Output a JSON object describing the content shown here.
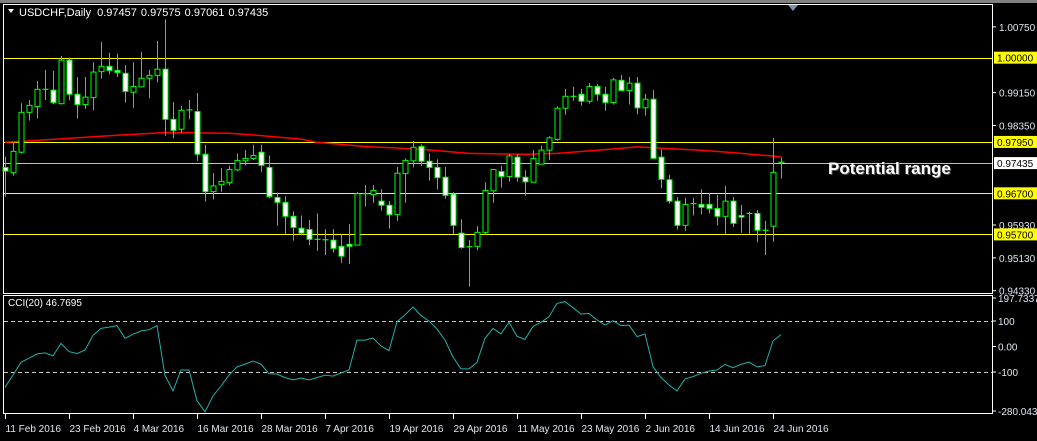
{
  "header": {
    "symbol_tf": "USDCHF,Daily",
    "open": "0.97457",
    "high": "0.97575",
    "low": "0.97061",
    "close": "0.97435"
  },
  "annotation": "Potential range",
  "colors": {
    "bull_body": "#000000",
    "bear_body": "#ffffff",
    "candle_outline": "#00ff00",
    "ma": "#ff0000",
    "level": "#ffff00",
    "current_price": "#c0c0c0",
    "cci": "#20b2aa"
  },
  "price_axis": {
    "ticks": [
      "1.00750",
      "0.99150",
      "0.98350",
      "0.95930",
      "0.95130",
      "0.94330"
    ],
    "levels": [
      "1.00000",
      "0.97950",
      "0.96700",
      "0.95700"
    ],
    "current": "0.97435"
  },
  "cci": {
    "label": "CCI(20) 46.7695",
    "axis": [
      "197.7337",
      "100",
      "0.00",
      "-100",
      "-280.0437"
    ],
    "values": [
      -160,
      -112,
      -62,
      -46,
      -29,
      -25,
      -37,
      12,
      -20,
      -28,
      -14,
      44,
      71,
      76,
      82,
      32,
      48,
      61,
      66,
      82,
      -114,
      -174,
      -92,
      -92,
      -212,
      -256,
      -194,
      -155,
      -112,
      -80,
      -69,
      -57,
      -69,
      -107,
      -108,
      -122,
      -131,
      -124,
      -131,
      -122,
      -112,
      -116,
      -104,
      -92,
      25,
      25,
      33,
      2,
      -16,
      97,
      124,
      155,
      121,
      100,
      69,
      25,
      -41,
      -88,
      -88,
      -62,
      32,
      71,
      50,
      95,
      40,
      28,
      79,
      95,
      117,
      169,
      176,
      152,
      127,
      130,
      104,
      84,
      101,
      82,
      84,
      39,
      49,
      -79,
      -122,
      -151,
      -174,
      -127,
      -118,
      -105,
      -96,
      -92,
      -70,
      -83,
      -70,
      -61,
      -80,
      -75,
      22,
      46.7695
    ]
  },
  "dates": [
    {
      "bar": 0,
      "label": "11 Feb 2016"
    },
    {
      "bar": 8,
      "label": "23 Feb 2016"
    },
    {
      "bar": 16,
      "label": "4 Mar 2016"
    },
    {
      "bar": 24,
      "label": "16 Mar 2016"
    },
    {
      "bar": 32,
      "label": "28 Mar 2016"
    },
    {
      "bar": 40,
      "label": "7 Apr 2016"
    },
    {
      "bar": 48,
      "label": "19 Apr 2016"
    },
    {
      "bar": 56,
      "label": "29 Apr 2016"
    },
    {
      "bar": 64,
      "label": "11 May 2016"
    },
    {
      "bar": 72,
      "label": "23 May 2016"
    },
    {
      "bar": 80,
      "label": "2 Jun 2016"
    },
    {
      "bar": 88,
      "label": "14 Jun 2016"
    },
    {
      "bar": 96,
      "label": "24 Jun 2016"
    }
  ],
  "chart_data": {
    "type": "candlestick",
    "symbol": "USDCHF",
    "timeframe": "Daily",
    "ylim": [
      0.9433,
      1.0075
    ],
    "levels": [
      1.0,
      0.9795,
      0.967,
      0.957
    ],
    "current_price": 0.97435,
    "ohlc": [
      [
        0.9733,
        0.9759,
        0.9662,
        0.9724
      ],
      [
        0.972,
        0.9793,
        0.9713,
        0.9772
      ],
      [
        0.977,
        0.9889,
        0.9767,
        0.9867
      ],
      [
        0.9867,
        0.9897,
        0.9847,
        0.9884
      ],
      [
        0.9881,
        0.9943,
        0.9852,
        0.9923
      ],
      [
        0.9923,
        0.997,
        0.9897,
        0.9922
      ],
      [
        0.9921,
        0.9968,
        0.9887,
        0.9891
      ],
      [
        0.9888,
        1.0004,
        0.9886,
        0.9994
      ],
      [
        0.9994,
        1.0,
        0.9896,
        0.9911
      ],
      [
        0.9911,
        0.9953,
        0.9852,
        0.9886
      ],
      [
        0.9886,
        0.9953,
        0.9875,
        0.9904
      ],
      [
        0.9903,
        0.9989,
        0.9872,
        0.9965
      ],
      [
        0.9966,
        1.0038,
        0.9949,
        0.9979
      ],
      [
        0.9979,
        1.0012,
        0.9959,
        0.9969
      ],
      [
        0.9969,
        1.001,
        0.9953,
        0.9964
      ],
      [
        0.9962,
        0.9982,
        0.9891,
        0.9918
      ],
      [
        0.9916,
        0.9989,
        0.9878,
        0.993
      ],
      [
        0.9929,
        1.0014,
        0.9928,
        0.995
      ],
      [
        0.995,
        0.997,
        0.9901,
        0.9957
      ],
      [
        0.9957,
        1.0041,
        0.994,
        0.9972
      ],
      [
        0.9972,
        1.0093,
        0.981,
        0.985
      ],
      [
        0.985,
        0.9892,
        0.9804,
        0.9823
      ],
      [
        0.9826,
        0.9882,
        0.9816,
        0.9872
      ],
      [
        0.987,
        0.9897,
        0.985,
        0.9873
      ],
      [
        0.9869,
        0.9914,
        0.9749,
        0.9765
      ],
      [
        0.9765,
        0.9788,
        0.965,
        0.9674
      ],
      [
        0.9674,
        0.9719,
        0.9655,
        0.9688
      ],
      [
        0.9691,
        0.9732,
        0.9674,
        0.9699
      ],
      [
        0.9696,
        0.9737,
        0.9689,
        0.9728
      ],
      [
        0.9727,
        0.9767,
        0.9724,
        0.975
      ],
      [
        0.9749,
        0.9775,
        0.9738,
        0.9755
      ],
      [
        0.9755,
        0.9788,
        0.9751,
        0.9762
      ],
      [
        0.977,
        0.9788,
        0.9722,
        0.9738
      ],
      [
        0.9733,
        0.9762,
        0.9658,
        0.9662
      ],
      [
        0.966,
        0.9672,
        0.9591,
        0.9648
      ],
      [
        0.9648,
        0.9663,
        0.9571,
        0.9614
      ],
      [
        0.9614,
        0.9626,
        0.9555,
        0.9587
      ],
      [
        0.9585,
        0.9616,
        0.9568,
        0.9573
      ],
      [
        0.9582,
        0.9605,
        0.9544,
        0.9558
      ],
      [
        0.9558,
        0.9621,
        0.953,
        0.9557
      ],
      [
        0.9557,
        0.9583,
        0.952,
        0.9556
      ],
      [
        0.9556,
        0.9583,
        0.9526,
        0.9536
      ],
      [
        0.9541,
        0.957,
        0.9501,
        0.9517
      ],
      [
        0.9546,
        0.9595,
        0.9498,
        0.9541
      ],
      [
        0.9544,
        0.9673,
        0.9543,
        0.9669
      ],
      [
        0.9669,
        0.969,
        0.9638,
        0.9668
      ],
      [
        0.9667,
        0.969,
        0.9647,
        0.9677
      ],
      [
        0.9651,
        0.968,
        0.9628,
        0.9641
      ],
      [
        0.9641,
        0.9651,
        0.9584,
        0.9618
      ],
      [
        0.9618,
        0.9734,
        0.9603,
        0.9719
      ],
      [
        0.9718,
        0.9755,
        0.9647,
        0.975
      ],
      [
        0.9749,
        0.9797,
        0.9733,
        0.9782
      ],
      [
        0.9784,
        0.9789,
        0.9736,
        0.9748
      ],
      [
        0.9748,
        0.9767,
        0.9701,
        0.9733
      ],
      [
        0.9733,
        0.9753,
        0.9679,
        0.9708
      ],
      [
        0.9709,
        0.9734,
        0.9657,
        0.9665
      ],
      [
        0.9668,
        0.9673,
        0.957,
        0.9592
      ],
      [
        0.9573,
        0.9607,
        0.9535,
        0.9538
      ],
      [
        0.9538,
        0.9556,
        0.9443,
        0.954
      ],
      [
        0.9541,
        0.959,
        0.9532,
        0.9575
      ],
      [
        0.9575,
        0.9697,
        0.9569,
        0.9677
      ],
      [
        0.9676,
        0.9728,
        0.9647,
        0.9728
      ],
      [
        0.9723,
        0.9737,
        0.9684,
        0.9711
      ],
      [
        0.9711,
        0.9766,
        0.9698,
        0.9761
      ],
      [
        0.9758,
        0.9765,
        0.9698,
        0.9709
      ],
      [
        0.9709,
        0.9726,
        0.9664,
        0.9698
      ],
      [
        0.9697,
        0.9775,
        0.9697,
        0.9755
      ],
      [
        0.9741,
        0.9786,
        0.9741,
        0.9775
      ],
      [
        0.9775,
        0.9809,
        0.9751,
        0.9805
      ],
      [
        0.9801,
        0.9882,
        0.9798,
        0.9877
      ],
      [
        0.9877,
        0.9924,
        0.9861,
        0.9906
      ],
      [
        0.9906,
        0.9929,
        0.9895,
        0.9905
      ],
      [
        0.9911,
        0.9924,
        0.9883,
        0.9894
      ],
      [
        0.9894,
        0.9938,
        0.9888,
        0.993
      ],
      [
        0.993,
        0.9936,
        0.9895,
        0.9911
      ],
      [
        0.9911,
        0.9929,
        0.9871,
        0.9891
      ],
      [
        0.9891,
        0.9951,
        0.9886,
        0.9946
      ],
      [
        0.9945,
        0.9958,
        0.992,
        0.992
      ],
      [
        0.992,
        0.9953,
        0.9886,
        0.9938
      ],
      [
        0.9938,
        0.9953,
        0.9862,
        0.9878
      ],
      [
        0.9878,
        0.9912,
        0.9859,
        0.9899
      ],
      [
        0.9899,
        0.9921,
        0.9755,
        0.9755
      ],
      [
        0.9758,
        0.9777,
        0.9682,
        0.9704
      ],
      [
        0.9703,
        0.9715,
        0.9645,
        0.9651
      ],
      [
        0.9651,
        0.9661,
        0.9582,
        0.9592
      ],
      [
        0.9592,
        0.9659,
        0.9579,
        0.9643
      ],
      [
        0.9643,
        0.9659,
        0.9616,
        0.9645
      ],
      [
        0.9643,
        0.968,
        0.9619,
        0.9636
      ],
      [
        0.9643,
        0.9671,
        0.9621,
        0.9633
      ],
      [
        0.9633,
        0.9666,
        0.9592,
        0.9614
      ],
      [
        0.9614,
        0.9688,
        0.9571,
        0.9651
      ],
      [
        0.9651,
        0.9661,
        0.9588,
        0.9597
      ],
      [
        0.9616,
        0.9642,
        0.9574,
        0.9612
      ],
      [
        0.9621,
        0.9625,
        0.9571,
        0.9621
      ],
      [
        0.9621,
        0.9629,
        0.9551,
        0.958
      ],
      [
        0.958,
        0.9603,
        0.952,
        0.9579
      ],
      [
        0.959,
        0.9805,
        0.9552,
        0.9721
      ],
      [
        0.97457,
        0.97575,
        0.97061,
        0.97435
      ]
    ],
    "moving_average": [
      [
        0,
        0.9794
      ],
      [
        5,
        0.98
      ],
      [
        12,
        0.9809
      ],
      [
        20,
        0.9818
      ],
      [
        28,
        0.9816
      ],
      [
        31,
        0.9812
      ],
      [
        37,
        0.9802
      ],
      [
        39,
        0.9794
      ],
      [
        45,
        0.9784
      ],
      [
        52,
        0.9777
      ],
      [
        58,
        0.9767
      ],
      [
        65,
        0.9765
      ],
      [
        69,
        0.9767
      ],
      [
        74,
        0.9775
      ],
      [
        79,
        0.9783
      ],
      [
        87,
        0.9775
      ],
      [
        91,
        0.9769
      ],
      [
        94,
        0.9764
      ],
      [
        97,
        0.9759
      ]
    ]
  }
}
